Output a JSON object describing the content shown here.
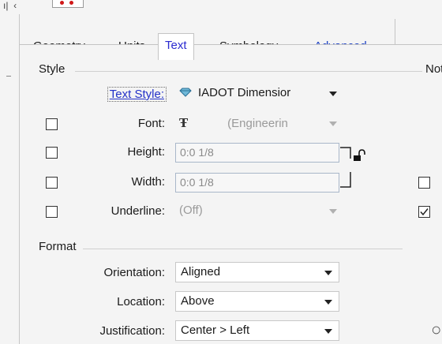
{
  "tabs": {
    "geometry": "Geometry",
    "units": "Units",
    "text": "Text",
    "symbology": "Symbology",
    "advanced": "Advanced"
  },
  "style_group": {
    "title": "Style",
    "text_style": {
      "label": "Text Style:",
      "value": "IADOT Dimensior"
    },
    "font": {
      "label": "Font:",
      "value": "(Engineerin"
    },
    "height": {
      "label": "Height:",
      "value": "0:0 1/8"
    },
    "width": {
      "label": "Width:",
      "value": "0:0 1/8"
    },
    "underline": {
      "label": "Underline:",
      "value": "(Off)"
    }
  },
  "right_group": {
    "title_partial": "Not",
    "checkbox_1_checked": false,
    "checkbox_2_checked": true
  },
  "format_group": {
    "title": "Format",
    "orientation": {
      "label": "Orientation:",
      "value": "Aligned"
    },
    "location": {
      "label": "Location:",
      "value": "Above"
    },
    "justification": {
      "label": "Justification:",
      "value": "Center > Left"
    }
  },
  "colors": {
    "active_tab_text": "#2b2bd0",
    "advanced_tab_text": "#1a3fc4",
    "link": "#2331c8",
    "lock_icon": "#111111"
  }
}
